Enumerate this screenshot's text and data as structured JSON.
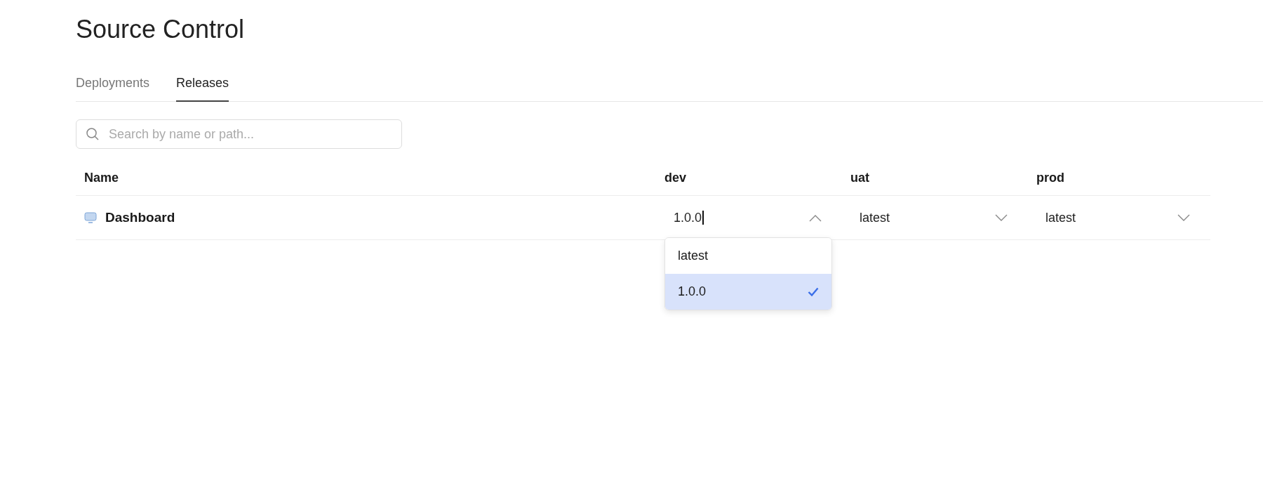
{
  "page": {
    "title": "Source Control"
  },
  "tabs": [
    {
      "label": "Deployments",
      "selected": false
    },
    {
      "label": "Releases",
      "selected": true
    }
  ],
  "search": {
    "placeholder": "Search by name or path..."
  },
  "table": {
    "columns": [
      "Name",
      "dev",
      "uat",
      "prod"
    ],
    "rows": [
      {
        "name": "Dashboard",
        "versions": [
          {
            "value": "1.0.0",
            "expanded": true,
            "options": [
              {
                "label": "latest",
                "selected": false
              },
              {
                "label": "1.0.0",
                "selected": true
              }
            ]
          },
          {
            "value": "latest",
            "expanded": false
          },
          {
            "value": "latest",
            "expanded": false
          }
        ]
      }
    ]
  }
}
